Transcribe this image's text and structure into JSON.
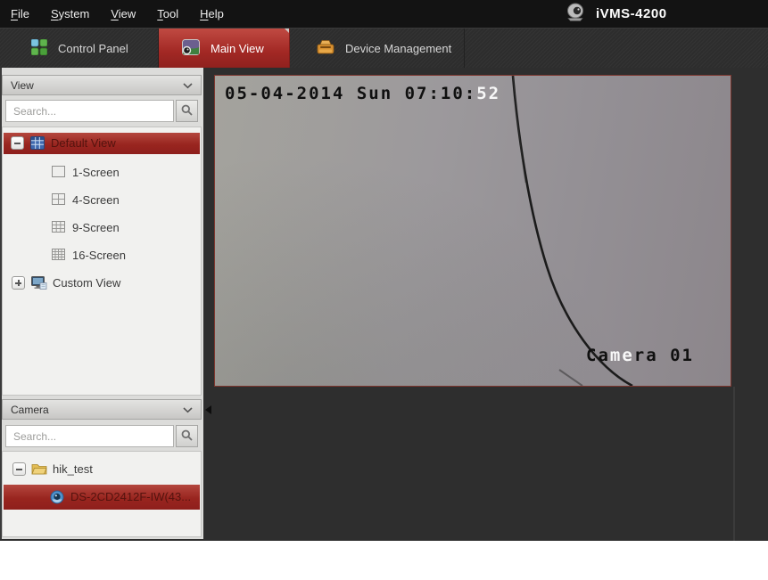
{
  "window": {
    "title": "iVMS-4200"
  },
  "menu": {
    "items": [
      "File",
      "System",
      "View",
      "Tool",
      "Help"
    ]
  },
  "tabs": {
    "control_panel": "Control Panel",
    "main_view": "Main View",
    "device_management": "Device Management"
  },
  "sidebar": {
    "view_panel": {
      "title": "View",
      "search_placeholder": "Search...",
      "root_item": "Default View",
      "items": [
        "1-Screen",
        "4-Screen",
        "9-Screen",
        "16-Screen"
      ],
      "custom_item": "Custom View"
    },
    "camera_panel": {
      "title": "Camera",
      "search_placeholder": "Search...",
      "group": "hik_test",
      "camera": "DS-2CD2412F-IW(43..."
    }
  },
  "video": {
    "timestamp": {
      "black": "05-04-2014 Sun 07:10:",
      "white": "52"
    },
    "camera_label": {
      "p1": "Ca",
      "p2": "me",
      "p3": "ra 01"
    }
  },
  "colors": {
    "selection_red": "#9e2b26",
    "tab_active_red": "#a22824",
    "menubar_black": "#131313",
    "panel_dark": "#2e2e2e",
    "sidebar_light": "#f1f1ef"
  }
}
